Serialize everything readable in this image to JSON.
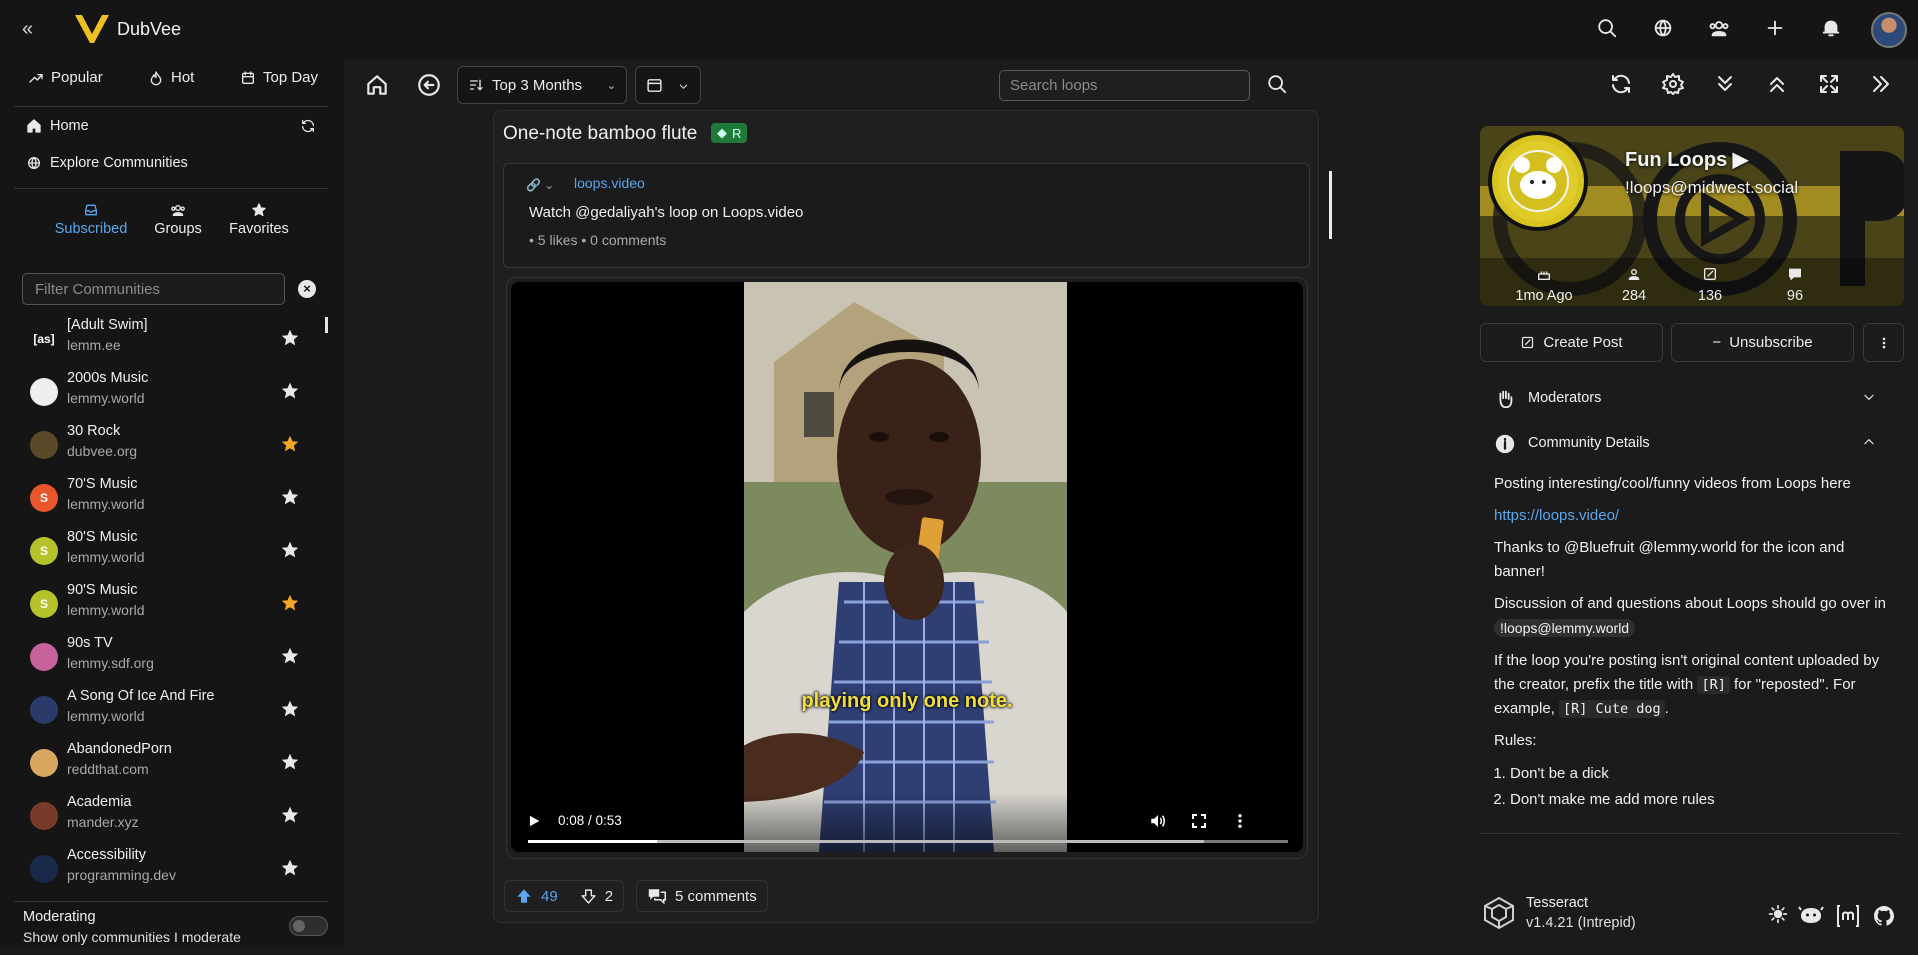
{
  "app": {
    "name": "DubVee"
  },
  "sidebar": {
    "sort_tabs": [
      {
        "label": "Popular",
        "icon": "trending-icon"
      },
      {
        "label": "Hot",
        "icon": "flame-icon"
      },
      {
        "label": "Top Day",
        "icon": "calendar-icon"
      }
    ],
    "nav": [
      {
        "label": "Home",
        "icon": "home-icon"
      },
      {
        "label": "Explore Communities",
        "icon": "globe-icon"
      }
    ],
    "sub_tabs": [
      {
        "label": "Subscribed",
        "icon": "inbox-icon",
        "active": true
      },
      {
        "label": "Groups",
        "icon": "users-icon",
        "active": false
      },
      {
        "label": "Favorites",
        "icon": "star-icon",
        "active": false
      }
    ],
    "filter_placeholder": "Filter Communities",
    "communities": [
      {
        "name": "[Adult Swim]",
        "instance": "lemm.ee",
        "avatar_text": "[as]",
        "avatar_color": "#151515",
        "favorite": false
      },
      {
        "name": "2000s Music",
        "instance": "lemmy.world",
        "avatar_text": "",
        "avatar_color": "#eeeeee",
        "favorite": false
      },
      {
        "name": "30 Rock",
        "instance": "dubvee.org",
        "avatar_text": "",
        "avatar_color": "#5a4a2a",
        "favorite": true
      },
      {
        "name": "70'S Music",
        "instance": "lemmy.world",
        "avatar_text": "S",
        "avatar_color": "#e8572b",
        "favorite": false
      },
      {
        "name": "80'S Music",
        "instance": "lemmy.world",
        "avatar_text": "S",
        "avatar_color": "#b5c22a",
        "favorite": false
      },
      {
        "name": "90'S Music",
        "instance": "lemmy.world",
        "avatar_text": "S",
        "avatar_color": "#b5c22a",
        "favorite": true
      },
      {
        "name": "90s TV",
        "instance": "lemmy.sdf.org",
        "avatar_text": "",
        "avatar_color": "#c8629e",
        "favorite": false
      },
      {
        "name": "A Song Of Ice And Fire",
        "instance": "lemmy.world",
        "avatar_text": "",
        "avatar_color": "#2a3a6a",
        "favorite": false
      },
      {
        "name": "AbandonedPorn",
        "instance": "reddthat.com",
        "avatar_text": "",
        "avatar_color": "#d8a860",
        "favorite": false
      },
      {
        "name": "Academia",
        "instance": "mander.xyz",
        "avatar_text": "",
        "avatar_color": "#7a3a2a",
        "favorite": false
      },
      {
        "name": "Accessibility",
        "instance": "programming.dev",
        "avatar_text": "",
        "avatar_color": "#1a2a4a",
        "favorite": false
      }
    ],
    "moderating": {
      "title": "Moderating",
      "subtitle": "Show only communities I moderate"
    }
  },
  "toolbar": {
    "sort_label": "Top 3 Months",
    "search_placeholder": "Search loops"
  },
  "post": {
    "title": "One-note bamboo flute",
    "tag": "R",
    "link": {
      "domain": "loops.video",
      "title": "Watch @gedaliyah's loop on Loops.video",
      "meta": "• 5 likes • 0 comments"
    },
    "video": {
      "caption": "playing only one note.",
      "time": "0:08 / 0:53",
      "progress_fraction": 0.17,
      "buffered_fraction": 0.89
    },
    "upvotes": "49",
    "downvotes": "2",
    "comments": "5 comments"
  },
  "community": {
    "title": "Fun Loops ▶",
    "handle": "!loops@midwest.social",
    "stats": [
      {
        "icon": "cake-icon",
        "value": "1mo Ago"
      },
      {
        "icon": "users-icon",
        "value": "284"
      },
      {
        "icon": "edit-icon",
        "value": "136"
      },
      {
        "icon": "chat-icon",
        "value": "96"
      }
    ],
    "create_post": "Create Post",
    "unsubscribe": "Unsubscribe",
    "moderators_label": "Moderators",
    "details_label": "Community Details",
    "details": {
      "p1": "Posting interesting/cool/funny videos from Loops here",
      "link": "https://loops.video/",
      "p2": "Thanks to @Bluefruit @lemmy.world for the icon and banner!",
      "p3_pre": "Discussion of and questions about Loops should go over in",
      "p3_pill": "!loops@lemmy.world",
      "p4_a": "If the loop you're posting isn't original content uploaded by the creator, prefix the title with",
      "p4_code1": "[R]",
      "p4_b": "for \"reposted\". For example,",
      "p4_code2": "[R] Cute dog",
      "p4_c": ".",
      "rules_label": "Rules:",
      "rules": [
        "Don't be a dick",
        "Don't make me add more rules"
      ]
    }
  },
  "footer": {
    "name": "Tesseract",
    "version": "v1.4.21 (Intrepid)"
  },
  "colors": {
    "accent": "#5aa6f0",
    "favorite": "#f5a623",
    "background": "#1b1b1b",
    "panel": "#151515"
  }
}
